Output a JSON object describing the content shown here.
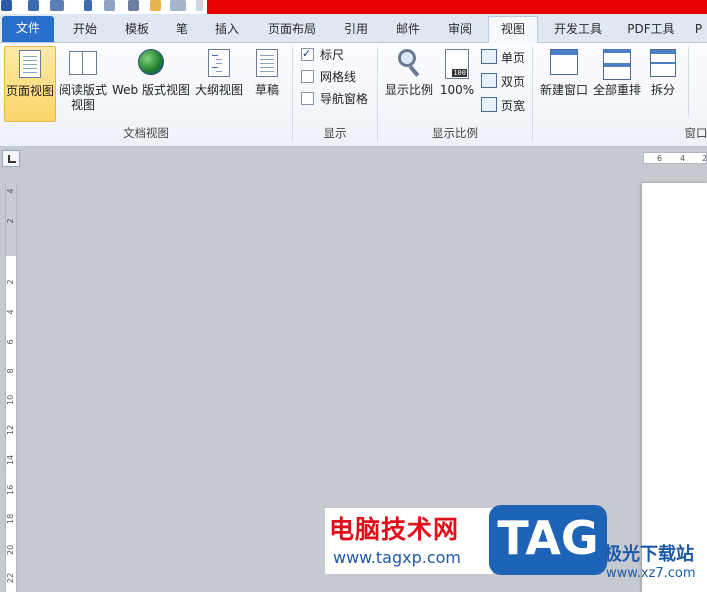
{
  "tabs": [
    "文件",
    "开始",
    "模板",
    "笔",
    "插入",
    "页面布局",
    "引用",
    "邮件",
    "审阅",
    "视图",
    "开发工具",
    "PDF工具",
    "P"
  ],
  "active_tab": "视图",
  "groups": {
    "doc_views": {
      "label": "文档视图",
      "buttons": [
        "页面视图",
        "阅读版式\n视图",
        "Web 版式视图",
        "大纲视图",
        "草稿"
      ]
    },
    "show": {
      "label": "显示",
      "items": [
        {
          "label": "标尺",
          "checked": true
        },
        {
          "label": "网格线",
          "checked": false
        },
        {
          "label": "导航窗格",
          "checked": false
        }
      ]
    },
    "zoom": {
      "label": "显示比例",
      "zoom_label": "显示比例",
      "hundred_label": "100%",
      "hundred_icon_text": "100",
      "small": [
        "单页",
        "双页",
        "页宽"
      ]
    },
    "window": {
      "label": "窗口",
      "buttons": [
        "新建窗口",
        "全部重排",
        "拆分"
      ]
    }
  },
  "top_ruler_ticks": [
    "6",
    "4",
    "2"
  ],
  "left_ruler_ticks": [
    "4",
    "2",
    "2",
    "4",
    "6",
    "8",
    "10",
    "12",
    "14",
    "16",
    "18",
    "20",
    "22"
  ],
  "watermark": {
    "title": "电脑技术网",
    "url": "www.tagxp.com",
    "logo": "TAG",
    "right_title": "极光下载站",
    "right_url": "www.xz7.com"
  }
}
